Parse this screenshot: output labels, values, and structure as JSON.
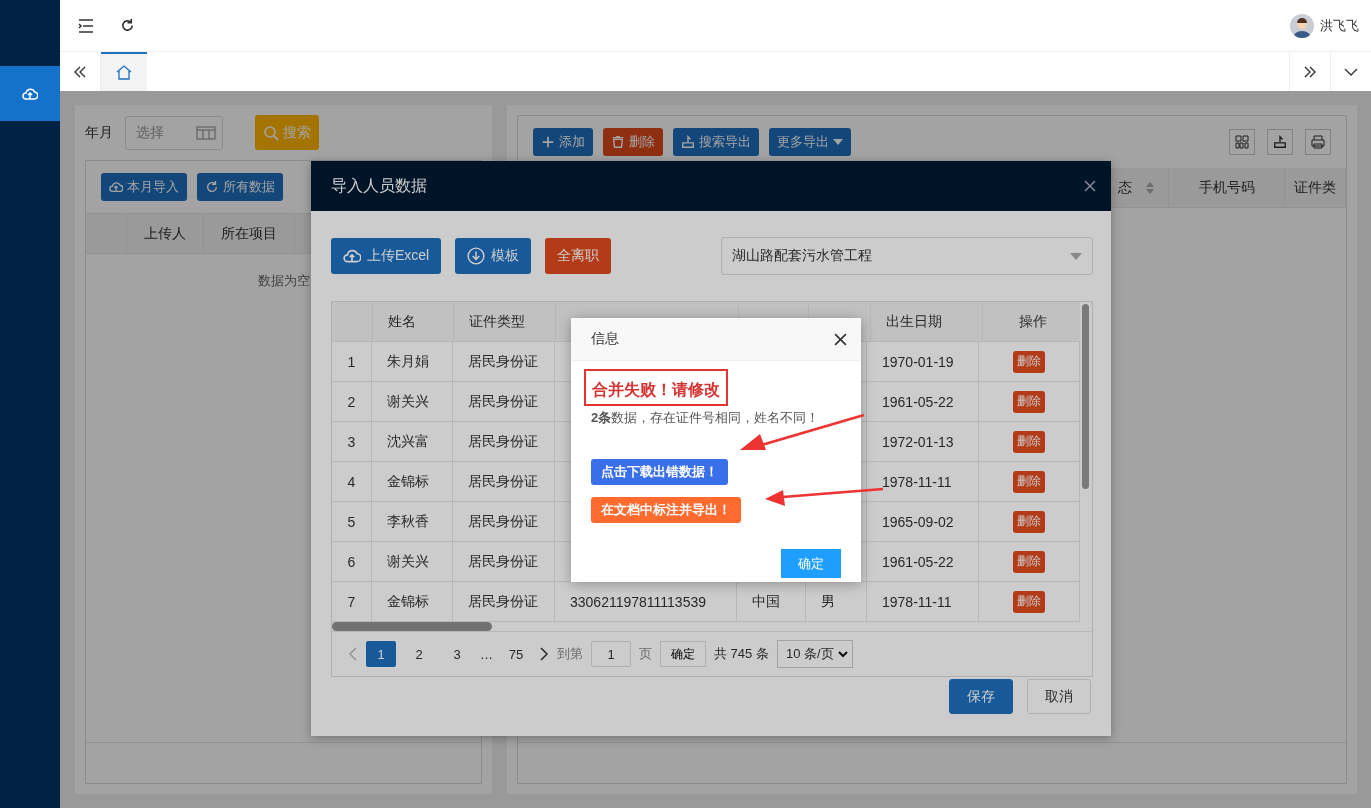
{
  "topbar": {
    "user": "洪飞飞"
  },
  "sidebar": {
    "items": [
      {
        "kind": "upload",
        "selected": true
      }
    ]
  },
  "tabs": [
    {
      "kind": "home",
      "selected": true
    }
  ],
  "left_panel": {
    "filter_label": "年月",
    "date_placeholder": "选择",
    "search_button": "搜索",
    "buttons": [
      {
        "label": "本月导入",
        "kind": "upload"
      },
      {
        "label": "所有数据",
        "kind": "refresh"
      }
    ],
    "columns": [
      "上传人",
      "所在项目"
    ],
    "empty_text": "数据为空"
  },
  "right_panel": {
    "buttons": [
      {
        "label": "添加",
        "kind": "add"
      },
      {
        "label": "删除",
        "kind": "delete"
      },
      {
        "label": "搜索导出",
        "kind": "export"
      },
      {
        "label": "更多导出",
        "kind": "more"
      }
    ],
    "columns": [
      "态",
      "手机号码",
      "证件类"
    ]
  },
  "import_dialog": {
    "title": "导入人员数据",
    "buttons": [
      {
        "label": "上传Excel",
        "kind": "upload"
      },
      {
        "label": "模板",
        "kind": "download"
      },
      {
        "label": "全离职",
        "kind": "danger"
      }
    ],
    "project": "湖山路配套污水管工程",
    "headers": {
      "name": "姓名",
      "id_type": "证件类型",
      "birth": "出生日期",
      "action": "操作"
    },
    "rows": [
      {
        "index": "1",
        "name": "朱月娟",
        "id_type": "居民身份证",
        "birth": "1970-01-19",
        "action": "删除"
      },
      {
        "index": "2",
        "name": "谢关兴",
        "id_type": "居民身份证",
        "birth": "1961-05-22",
        "action": "删除"
      },
      {
        "index": "3",
        "name": "沈兴富",
        "id_type": "居民身份证",
        "birth": "1972-01-13",
        "action": "删除"
      },
      {
        "index": "4",
        "name": "金锦标",
        "id_type": "居民身份证",
        "birth": "1978-11-11",
        "action": "删除"
      },
      {
        "index": "5",
        "name": "李秋香",
        "id_type": "居民身份证",
        "birth": "1965-09-02",
        "action": "删除"
      },
      {
        "index": "6",
        "name": "谢关兴",
        "id_type": "居民身份证",
        "birth": "1961-05-22",
        "action": "删除"
      },
      {
        "index": "7",
        "name": "金锦标",
        "id_type": "居民身份证",
        "id_number": "330621197811113539",
        "nationality": "中国",
        "sex": "男",
        "birth": "1978-11-11",
        "action": "删除"
      }
    ],
    "pagination": {
      "pages": [
        {
          "label": "1",
          "kind": "page",
          "selected": true
        },
        {
          "label": "2",
          "kind": "page",
          "selected": false
        },
        {
          "label": "3",
          "kind": "page",
          "selected": false
        },
        {
          "label": "…",
          "kind": "ellipsis"
        },
        {
          "label": "75",
          "kind": "page",
          "selected": false
        }
      ],
      "goto_label": "到第",
      "goto_value": "1",
      "page_unit": "页",
      "goto_button": "确定",
      "total": "共 745 条",
      "page_size": "10 条/页"
    },
    "footer_buttons": [
      {
        "label": "保存",
        "kind": "primary"
      },
      {
        "label": "取消",
        "kind": "default"
      }
    ]
  },
  "message_dialog": {
    "title": "信息",
    "heading": "合并失败！请修改",
    "detail": "**2条**数据，存在证件号相同，姓名不同！",
    "buttons": [
      {
        "label": "点击下载出错数据！",
        "kind": "download"
      },
      {
        "label": "在文档中标注并导出！",
        "kind": "mark"
      }
    ],
    "confirm": "确定"
  }
}
